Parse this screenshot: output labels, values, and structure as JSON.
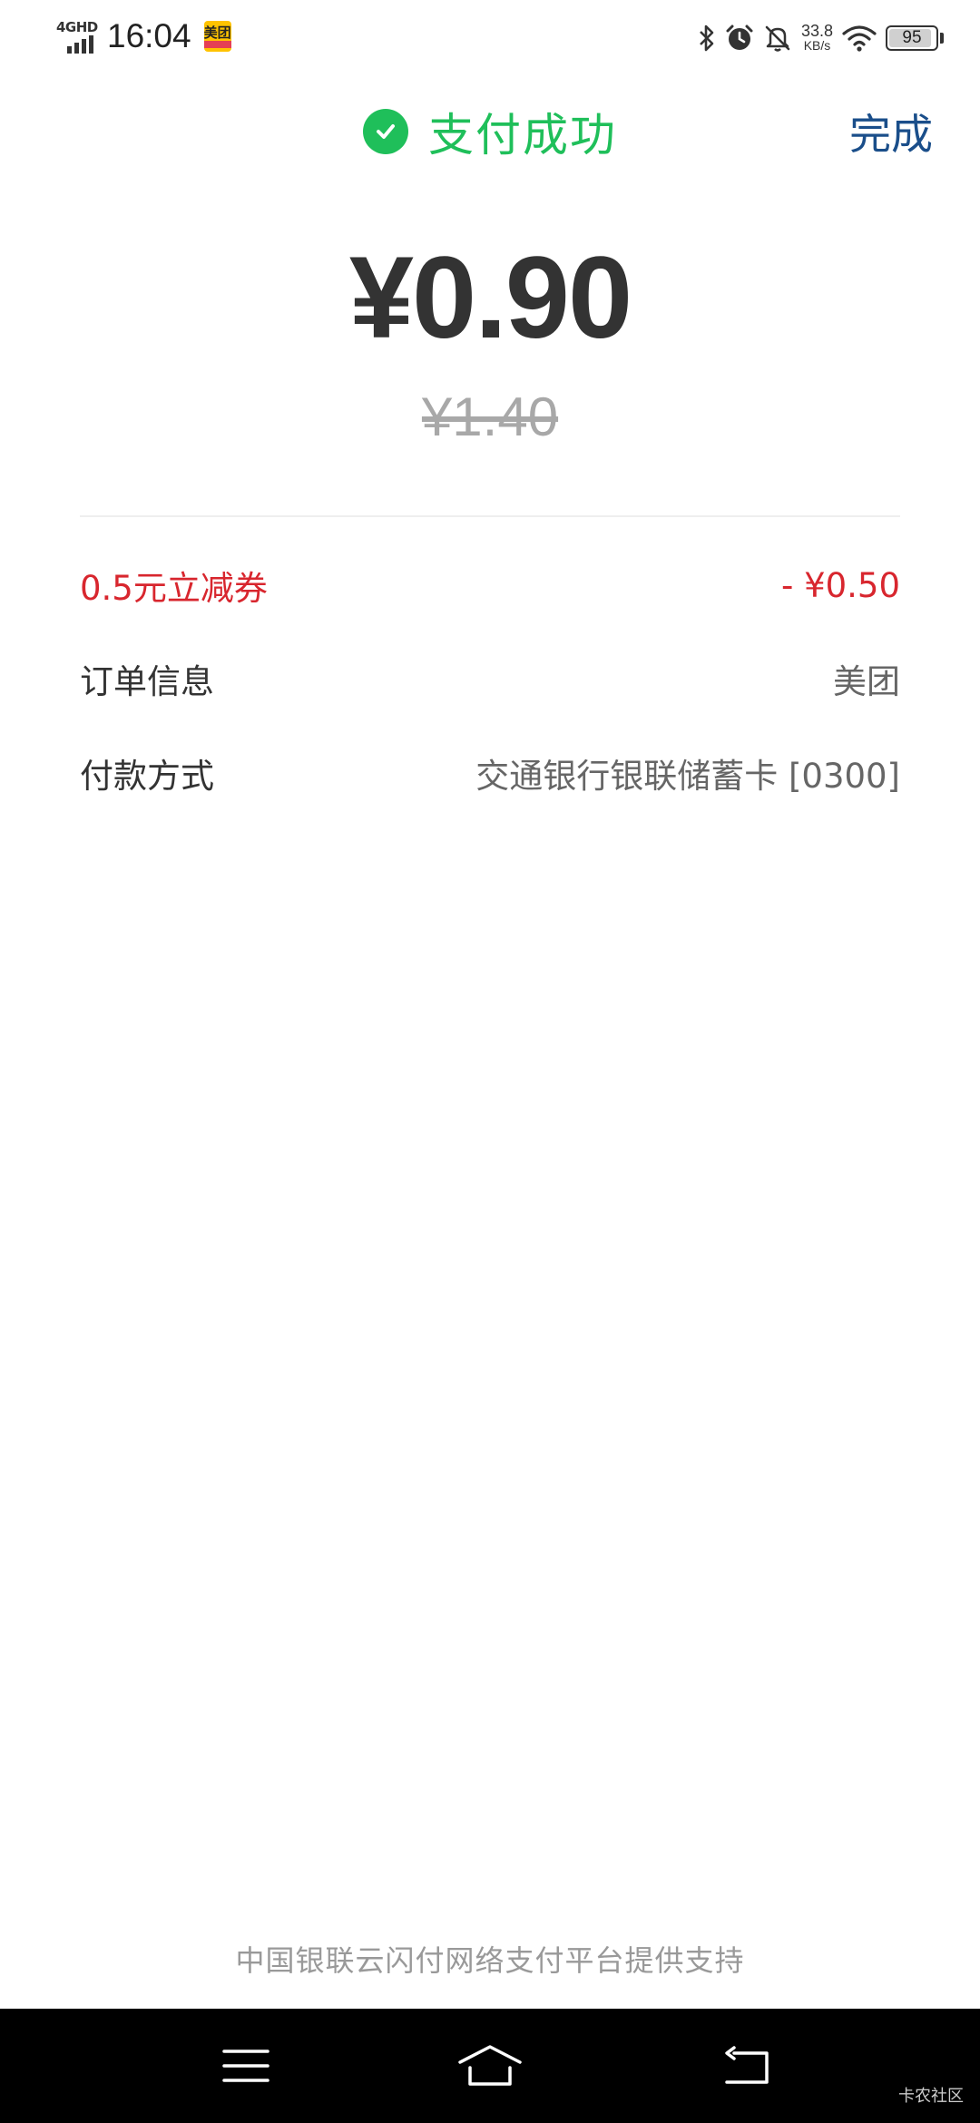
{
  "status_bar": {
    "network": "4GHD",
    "time": "16:04",
    "app_badge": "美团",
    "net_speed_value": "33.8",
    "net_speed_unit": "KB/s",
    "battery_level": "95",
    "battery_fraction": 0.95,
    "icons": [
      "bluetooth-icon",
      "alarm-icon",
      "mute-icon",
      "wifi-icon",
      "battery-icon"
    ]
  },
  "header": {
    "title": "支付成功",
    "done_label": "完成",
    "title_color": "#1fbf5a",
    "done_color": "#1a4e8a"
  },
  "payment": {
    "amount": "¥0.90",
    "original_amount": "¥1.40"
  },
  "details": {
    "coupon_label": "0.5元立减券",
    "coupon_value": "- ¥0.50",
    "order_label": "订单信息",
    "order_value": "美团",
    "pay_method_label": "付款方式",
    "pay_method_value": "交通银行银联储蓄卡 [0300]",
    "accent_color": "#d8262e"
  },
  "footer": {
    "support_text": "中国银联云闪付网络支付平台提供支持",
    "watermark": "卡农社区"
  },
  "nav_bar": {
    "icons": [
      "menu-icon",
      "home-icon",
      "back-icon"
    ]
  }
}
